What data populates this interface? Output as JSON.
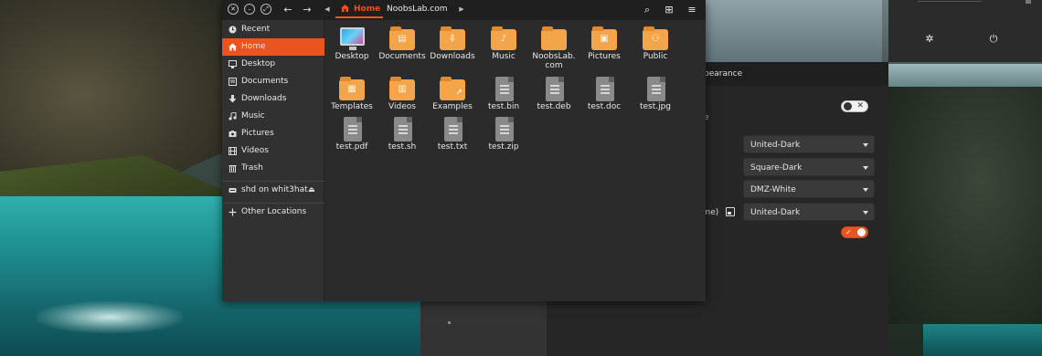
{
  "colors": {
    "accent": "#e95420",
    "folder": "#f4a549",
    "panel_bg": "#2b2b2b",
    "sidebar_bg": "#313131"
  },
  "files_window": {
    "header": {
      "window_buttons": [
        "close",
        "minimize",
        "maximize"
      ],
      "breadcrumbs": [
        {
          "label": "Home",
          "icon": "home-icon",
          "active": true
        },
        {
          "label": "NoobsLab.com",
          "active": false
        }
      ],
      "toolbar_icons": [
        "search-icon",
        "grid-view-icon",
        "menu-icon"
      ]
    },
    "sidebar": {
      "items": [
        {
          "label": "Recent",
          "icon": "clock-icon"
        },
        {
          "label": "Home",
          "icon": "home-icon",
          "active": true
        },
        {
          "label": "Desktop",
          "icon": "desktop-icon"
        },
        {
          "label": "Documents",
          "icon": "document-icon"
        },
        {
          "label": "Downloads",
          "icon": "download-icon"
        },
        {
          "label": "Music",
          "icon": "music-icon"
        },
        {
          "label": "Pictures",
          "icon": "camera-icon"
        },
        {
          "label": "Videos",
          "icon": "film-icon"
        },
        {
          "label": "Trash",
          "icon": "trash-icon"
        }
      ],
      "network_drive": {
        "label": "shd on whit3hat",
        "icon": "network-drive-icon"
      },
      "other_locations": {
        "label": "Other Locations",
        "icon": "plus-icon"
      }
    },
    "files": [
      {
        "name": "Desktop",
        "kind": "desktop"
      },
      {
        "name": "Documents",
        "kind": "folder",
        "emblem": "document-emblem-icon"
      },
      {
        "name": "Downloads",
        "kind": "folder",
        "emblem": "download-emblem-icon"
      },
      {
        "name": "Music",
        "kind": "folder",
        "emblem": "music-emblem-icon"
      },
      {
        "name": "NoobsLab.\ncom",
        "kind": "folder"
      },
      {
        "name": "Pictures",
        "kind": "folder",
        "emblem": "picture-emblem-icon"
      },
      {
        "name": "Public",
        "kind": "folder",
        "emblem": "people-emblem-icon"
      },
      {
        "name": "Templates",
        "kind": "folder",
        "emblem": "template-emblem-icon"
      },
      {
        "name": "Videos",
        "kind": "folder",
        "emblem": "film-emblem-icon"
      },
      {
        "name": "Examples",
        "kind": "folder",
        "emblem": "link-emblem-icon"
      },
      {
        "name": "test.bin",
        "kind": "doc"
      },
      {
        "name": "test.deb",
        "kind": "doc"
      },
      {
        "name": "test.doc",
        "kind": "doc"
      },
      {
        "name": "test.jpg",
        "kind": "doc"
      },
      {
        "name": "test.pdf",
        "kind": "doc"
      },
      {
        "name": "test.sh",
        "kind": "doc"
      },
      {
        "name": "test.txt",
        "kind": "doc"
      },
      {
        "name": "test.zip",
        "kind": "doc"
      }
    ]
  },
  "settings_window": {
    "title_fragment": "pearance",
    "colon_fragment": "e",
    "row_fragment": "one)",
    "combos": [
      "United-Dark",
      "Square-Dark",
      "DMZ-White",
      "United-Dark"
    ],
    "toggle_top": {
      "state": "off"
    },
    "toggle_bottom": {
      "state": "on"
    }
  },
  "top_panel": {
    "icons": [
      "settings-tools-icon",
      "power-icon"
    ]
  }
}
